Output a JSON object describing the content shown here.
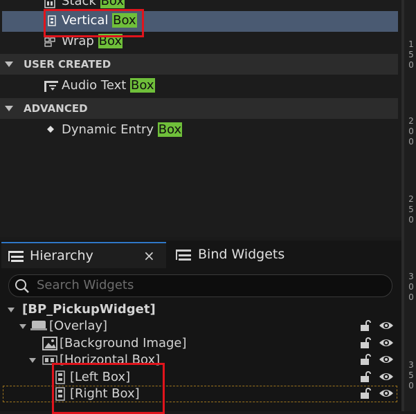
{
  "palette": {
    "items": [
      {
        "label": "Stack",
        "highlight": "Box"
      },
      {
        "label": "Vertical",
        "highlight": "Box"
      },
      {
        "label": "Wrap",
        "highlight": "Box"
      },
      {
        "label": "Audio Text",
        "highlight": "Box"
      },
      {
        "label": "Dynamic Entry",
        "highlight": "Box"
      }
    ],
    "categories": [
      "USER CREATED",
      "ADVANCED"
    ]
  },
  "ruler": {
    "marks": [
      [
        "1",
        "5",
        "0"
      ],
      [
        "2",
        "0",
        "0"
      ],
      [
        "2",
        "5",
        "0"
      ],
      [
        "3",
        "0",
        "0"
      ],
      [
        "3",
        "5",
        "0"
      ]
    ]
  },
  "tabs": {
    "hierarchy": "Hierarchy",
    "close": "×",
    "bind_widgets": "Bind Widgets"
  },
  "search": {
    "placeholder": "Search Widgets"
  },
  "tree": [
    "[BP_PickupWidget]",
    "[Overlay]",
    "[Background Image]",
    "[Horizontal Box]",
    "[Left Box]",
    "[Right Box]"
  ],
  "colors": {
    "highlight": "#6fbf3a",
    "selection": "#4a5a72",
    "annotation": "#e0141c"
  }
}
